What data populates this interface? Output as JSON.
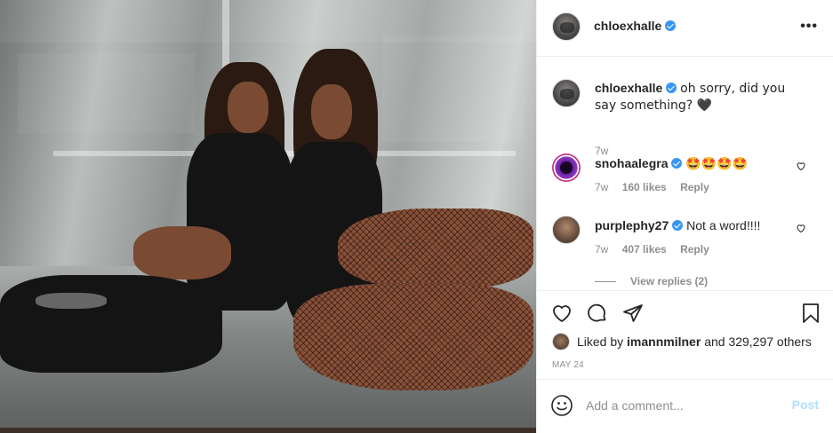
{
  "post": {
    "author": "chloexhalle",
    "caption": "oh sorry, did you say something? 🖤",
    "caption_age": "7w",
    "liked_by_prefix": "Liked by",
    "liked_by_user": "imannmilner",
    "liked_by_suffix": "and 329,297 others",
    "date": "MAY 24"
  },
  "comments": [
    {
      "username": "snohaalegra",
      "text": "🤩🤩🤩🤩",
      "age": "7w",
      "likes": "160 likes",
      "reply": "Reply",
      "avatar_color": "#6a1fa0"
    },
    {
      "username": "purplephy27",
      "text": "Not a word!!!!",
      "age": "7w",
      "likes": "407 likes",
      "reply": "Reply",
      "avatar_color": "#5a4638"
    }
  ],
  "view_replies": "View replies (2)",
  "add_comment": {
    "placeholder": "Add a comment...",
    "post_label": "Post"
  },
  "icons": {
    "more": "more-options-icon",
    "like": "heart-icon",
    "comment": "comment-icon",
    "share": "paper-plane-icon",
    "save": "bookmark-icon",
    "emoji": "emoji-icon",
    "verified": "verified-badge-icon"
  },
  "colors": {
    "verified": "#3897f0",
    "secondary_text": "#8e8e8e",
    "post_button_disabled": "#b2dffc"
  }
}
